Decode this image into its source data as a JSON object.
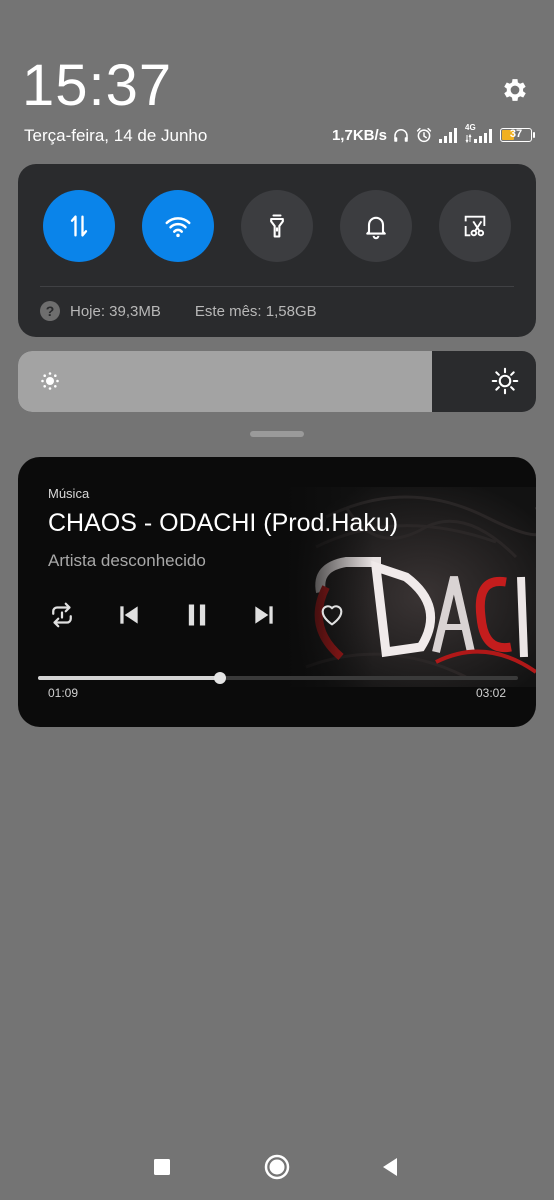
{
  "status": {
    "time": "15:37",
    "date": "Terça-feira, 14 de Junho",
    "net_speed": "1,7KB/s",
    "network_label": "4G",
    "battery": "37"
  },
  "quick_settings": {
    "tiles": [
      {
        "icon": "mobile-data-icon",
        "active": true
      },
      {
        "icon": "wifi-icon",
        "active": true
      },
      {
        "icon": "flashlight-icon",
        "active": false
      },
      {
        "icon": "bell-icon",
        "active": false
      },
      {
        "icon": "screenshot-icon",
        "active": false
      }
    ],
    "data_usage": {
      "today": "Hoje: 39,3MB",
      "month": "Este mês: 1,58GB"
    },
    "brightness_level": 0.8
  },
  "media": {
    "app": "Música",
    "title": "CHAOS - ODACHI (Prod.Haku)",
    "artist": "Artista desconhecido",
    "current_time": "01:09",
    "total_time": "03:02",
    "progress": 0.38,
    "art_text": "ODACHI"
  },
  "colors": {
    "accent": "#0a84ea",
    "background": "#747474",
    "panel": "#2a2b2d",
    "battery": "#f0b020"
  }
}
